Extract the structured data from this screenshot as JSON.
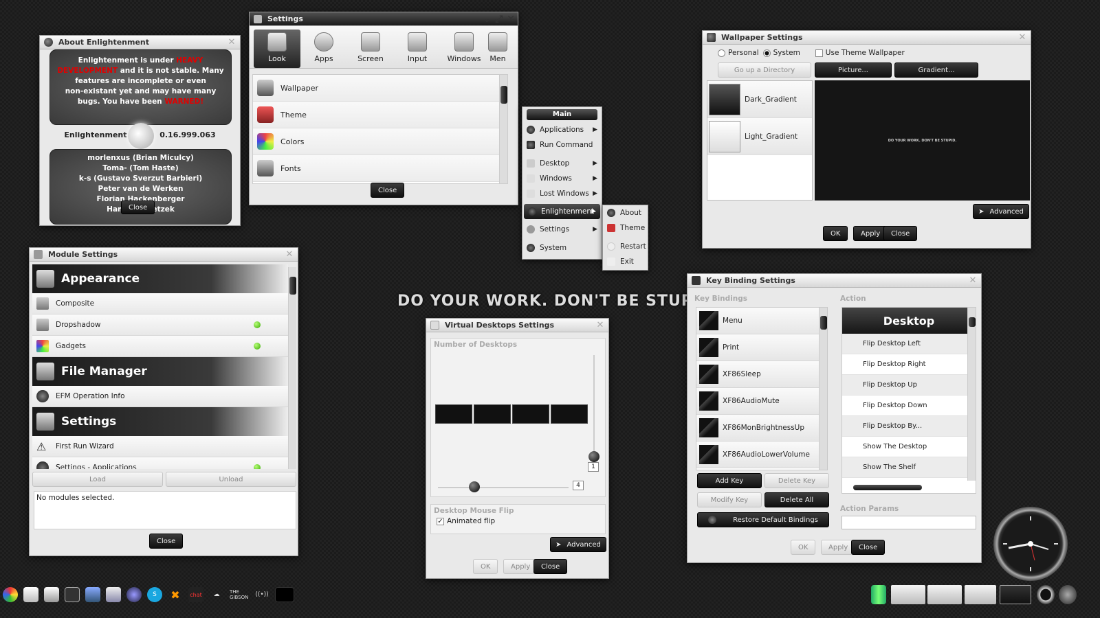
{
  "about": {
    "title": "About Enlightenment",
    "top_line1": "Enlightenment is under",
    "top_heavy": "HEAVY",
    "top_dev": "DEVELOPMENT",
    "top_line2": "and it is not stable. Many",
    "top_line3": "features are incomplete or even",
    "top_line4": "non-existant yet and may have many",
    "top_line5": "bugs. You have been",
    "top_warned": "WARNED!",
    "version_label": "Enlightenment",
    "version": "0.16.999.063",
    "authors": [
      "morlenxus (Brian Miculcy)",
      "Toma- (Tom Haste)",
      "k-s (Gustavo Sverzut Barbieri)",
      "Peter van de Werken",
      "Florian Hackenberger",
      "Hannes Janetzek"
    ],
    "close_label": "Close"
  },
  "settings": {
    "title": "Settings",
    "tabs": [
      "Look",
      "Apps",
      "Screen",
      "Input",
      "Windows",
      "Men"
    ],
    "items": [
      "Wallpaper",
      "Theme",
      "Colors",
      "Fonts"
    ],
    "close_label": "Close"
  },
  "main_menu": {
    "header": "Main",
    "items": [
      "Applications",
      "Run Command",
      "Desktop",
      "Windows",
      "Lost Windows",
      "Enlightenment",
      "Settings",
      "System"
    ],
    "submenu": [
      "About",
      "Theme",
      "Restart",
      "Exit"
    ]
  },
  "wallpaper": {
    "title": "Wallpaper Settings",
    "personal": "Personal",
    "system": "System",
    "use_theme": "Use Theme Wallpaper",
    "go_up": "Go up a Directory",
    "picture_btn": "Picture...",
    "gradient_btn": "Gradient...",
    "items": [
      "Dark_Gradient",
      "Light_Gradient"
    ],
    "preview_text": "DO YOUR WORK. DON'T BE STUPID.",
    "advanced": "Advanced",
    "ok": "OK",
    "apply": "Apply",
    "close": "Close"
  },
  "modules": {
    "title": "Module Settings",
    "cat1": "Appearance",
    "cat1_items": [
      "Composite",
      "Dropshadow",
      "Gadgets"
    ],
    "cat2": "File Manager",
    "cat2_items": [
      "EFM Operation Info"
    ],
    "cat3": "Settings",
    "cat3_items": [
      "First Run Wizard",
      "Settings - Applications"
    ],
    "load": "Load",
    "unload": "Unload",
    "status": "No modules selected.",
    "close": "Close"
  },
  "slogan": "DO YOUR WORK. DON'T BE STUPID.",
  "vdesk": {
    "title": "Virtual Desktops Settings",
    "num_label": "Number of Desktops",
    "rows_value": "1",
    "cols_value": "4",
    "flip_label": "Desktop Mouse Flip",
    "animated": "Animated flip",
    "advanced": "Advanced",
    "ok": "OK",
    "apply": "Apply",
    "close": "Close"
  },
  "keys": {
    "title": "Key Binding Settings",
    "bindings_label": "Key Bindings",
    "action_label": "Action",
    "bindings": [
      "Menu",
      "Print",
      "XF86Sleep",
      "XF86AudioMute",
      "XF86MonBrightnessUp",
      "XF86AudioLowerVolume"
    ],
    "action_header": "Desktop",
    "actions": [
      "Flip Desktop Left",
      "Flip Desktop Right",
      "Flip Desktop Up",
      "Flip Desktop Down",
      "Flip Desktop By...",
      "Show The Desktop",
      "Show The Shelf"
    ],
    "add_key": "Add Key",
    "delete_key": "Delete Key",
    "modify_key": "Modify Key",
    "delete_all": "Delete All",
    "restore": "Restore Default Bindings",
    "params_label": "Action Params",
    "ok": "OK",
    "apply": "Apply",
    "close": "Close"
  },
  "taskbar": {
    "gibson": "THE GIBSON"
  }
}
